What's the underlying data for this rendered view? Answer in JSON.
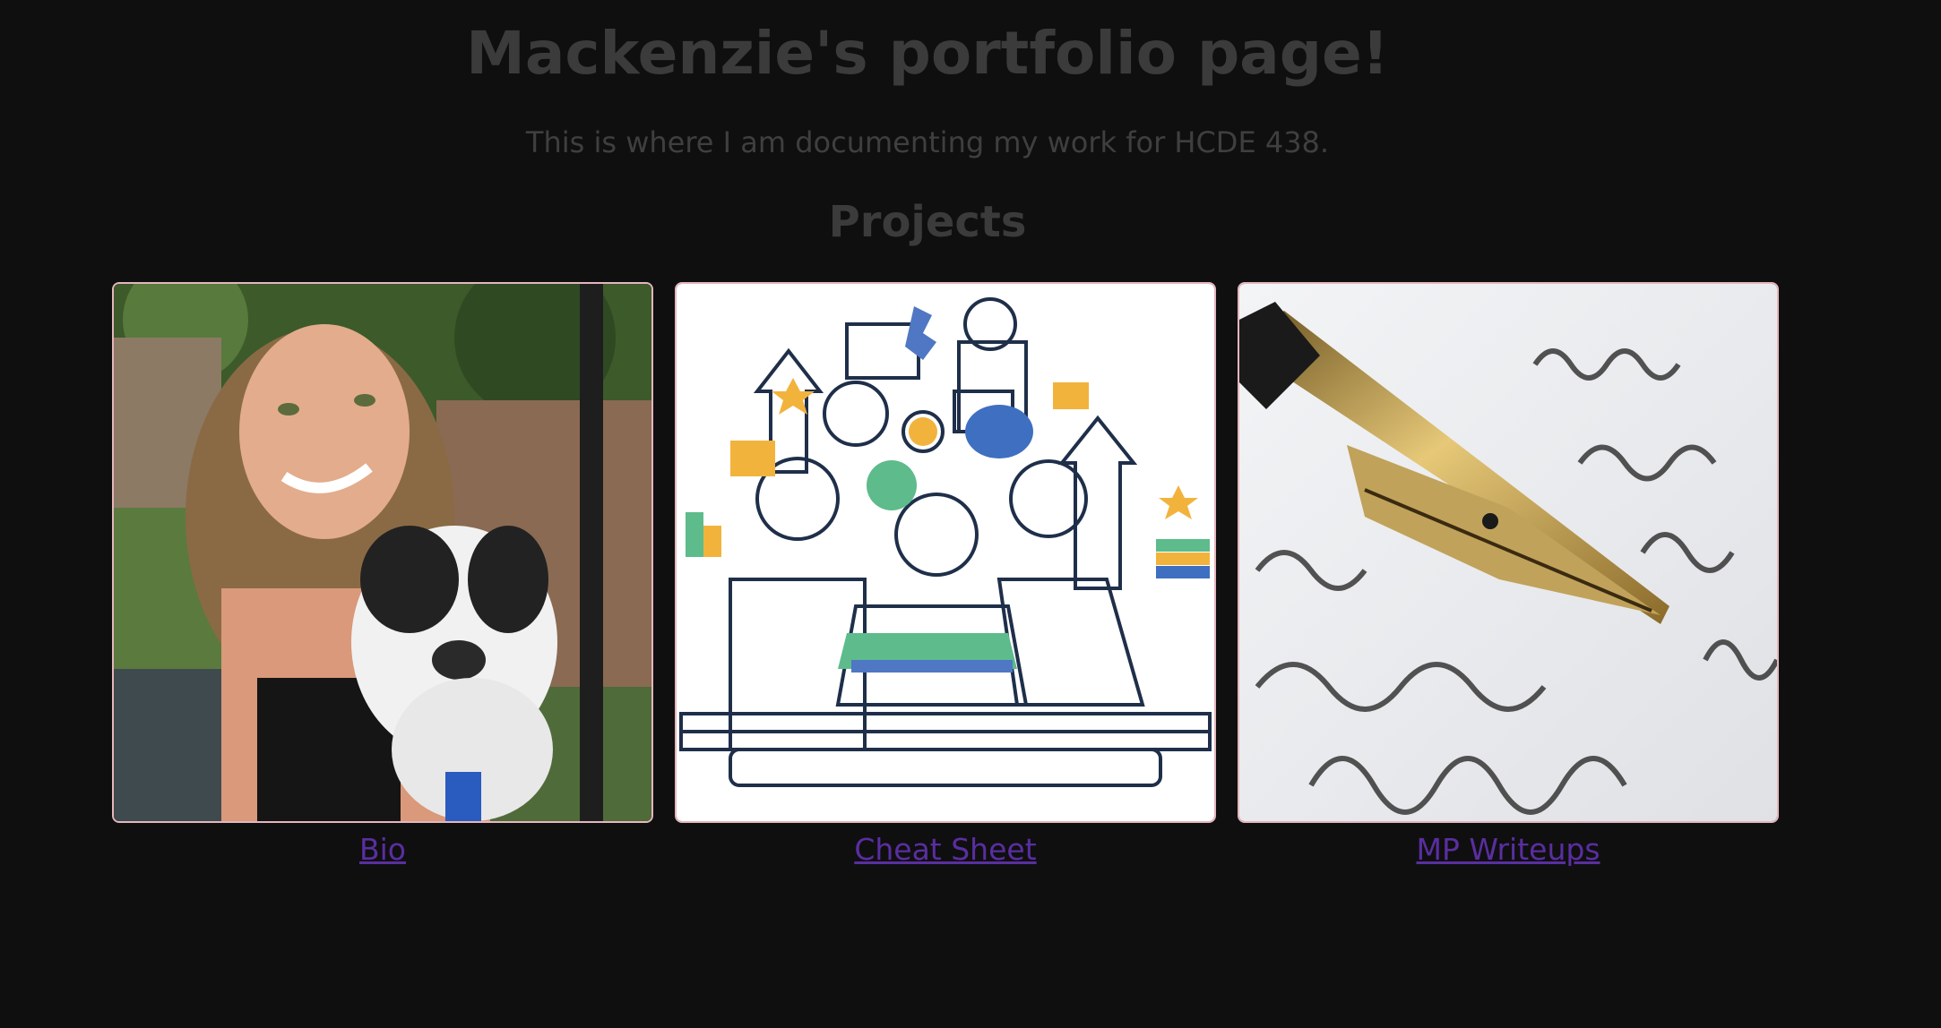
{
  "header": {
    "title": "Mackenzie's portfolio page!",
    "intro": "This is where I am documenting my work for HCDE 438."
  },
  "projects": {
    "heading": "Projects",
    "cards": [
      {
        "label": "Bio",
        "image": "portrait-with-dog-photo"
      },
      {
        "label": "Cheat Sheet",
        "image": "team-collaboration-line-illustration"
      },
      {
        "label": "MP Writeups",
        "image": "fountain-pen-on-handwriting-photo"
      }
    ]
  },
  "colors": {
    "background": "#0f0f10",
    "heading_text": "#3b3b3b",
    "link": "#5a2ea0",
    "card_border": "#e4b6bc"
  }
}
